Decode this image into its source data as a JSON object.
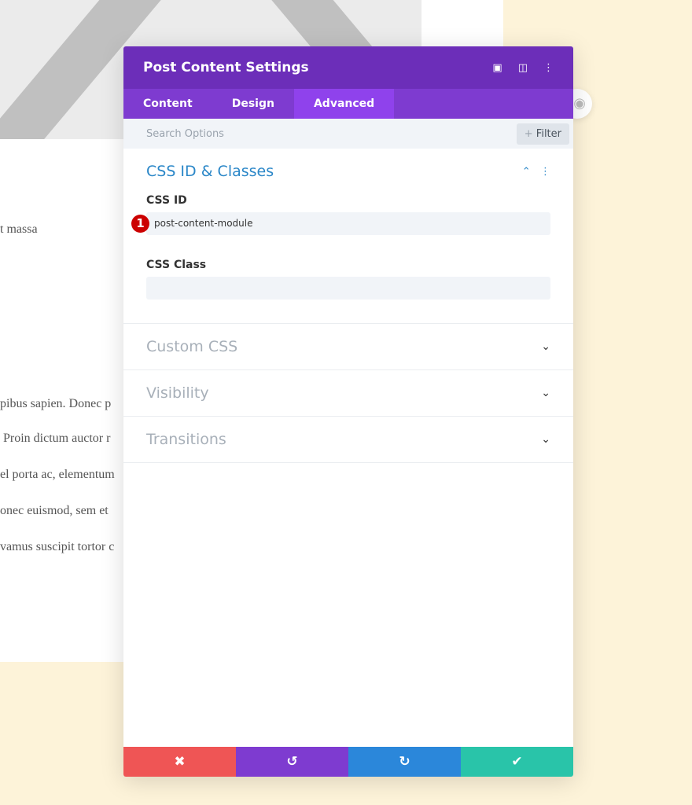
{
  "background": {
    "text_lines": [
      "t massa",
      "pibus sapien. Donec p",
      "Proin dictum auctor r",
      "el porta ac, elementum",
      "onec euismod, sem et",
      "vamus suscipit tortor c"
    ]
  },
  "panel": {
    "title": "Post Content Settings",
    "header_icons": [
      "expand-icon",
      "sidebar-icon",
      "more-icon"
    ],
    "tabs": [
      {
        "label": "Content"
      },
      {
        "label": "Design"
      },
      {
        "label": "Advanced",
        "active": true
      }
    ],
    "search_placeholder": "Search Options",
    "filter_label": "Filter",
    "sections": [
      {
        "title": "CSS ID & Classes",
        "open": true,
        "fields": [
          {
            "label": "CSS ID",
            "value": "post-content-module",
            "badge": "1"
          },
          {
            "label": "CSS Class",
            "value": ""
          }
        ]
      },
      {
        "title": "Custom CSS"
      },
      {
        "title": "Visibility"
      },
      {
        "title": "Transitions"
      }
    ],
    "footer_colors": {
      "cancel": "#ef5555",
      "undo": "#7e3bd0",
      "redo": "#2b87da",
      "save": "#29c4a9"
    }
  },
  "colors": {
    "header": "#6c2eb9",
    "tabs": "#7e3bd0",
    "active_tab": "#8f42ec",
    "accent": "#2b87c8"
  }
}
